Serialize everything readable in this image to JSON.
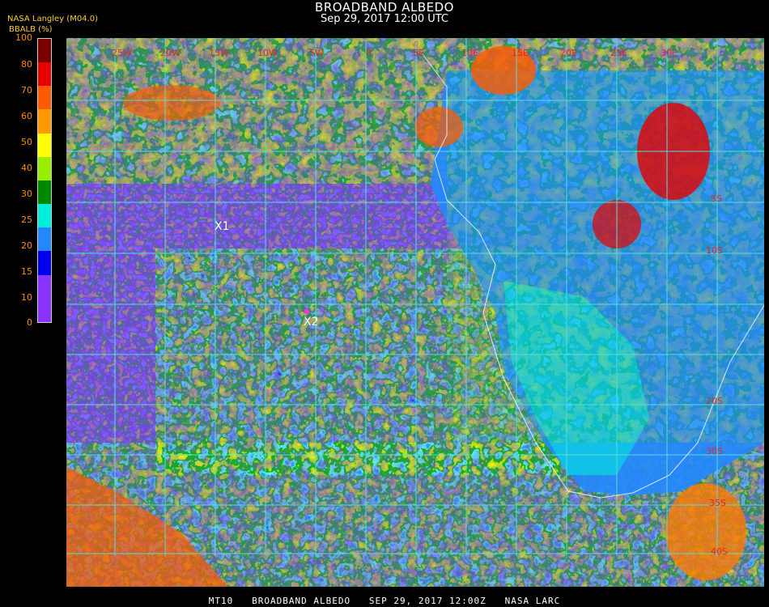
{
  "header": {
    "title": "BROADBAND ALBEDO",
    "subtitle": "Sep 29, 2017 12:00 UTC",
    "source": "NASA Langley (M04.0)"
  },
  "colorbar": {
    "label": "BBALB (%)",
    "ticks": [
      "100",
      "80",
      "70",
      "60",
      "50",
      "40",
      "30",
      "25",
      "20",
      "15",
      "10",
      "0"
    ],
    "colors": [
      "#7a0000",
      "#e60000",
      "#ff5a00",
      "#ff9900",
      "#ffff00",
      "#99ee00",
      "#008800",
      "#00eedd",
      "#2288ff",
      "#0000ee",
      "#8833ff"
    ]
  },
  "map": {
    "lon_labels": [
      "25W",
      "20W",
      "15W",
      "10W",
      "5W",
      "0",
      "5E",
      "10E",
      "15E",
      "20E",
      "25E",
      "30E"
    ],
    "lat_labels": [
      "5S",
      "10S",
      "20S",
      "30S",
      "35S",
      "40S"
    ],
    "markers": [
      {
        "id": "X1",
        "label": "X1"
      },
      {
        "id": "X2",
        "label": "X2"
      }
    ]
  },
  "footer": {
    "text": "MT10   BROADBAND ALBEDO   SEP 29, 2017 12:00Z   NASA LARC"
  }
}
